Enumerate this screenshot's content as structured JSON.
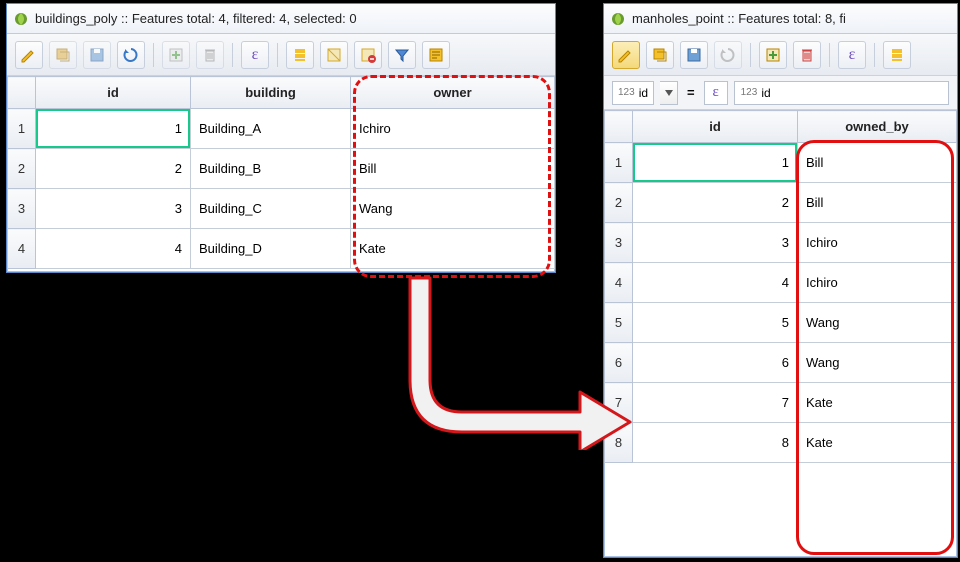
{
  "left": {
    "title": "buildings_poly :: Features total: 4, filtered: 4, selected: 0",
    "columns": [
      "id",
      "building",
      "owner"
    ],
    "rows": [
      {
        "n": "1",
        "id": "1",
        "building": "Building_A",
        "owner": "Ichiro"
      },
      {
        "n": "2",
        "id": "2",
        "building": "Building_B",
        "owner": "Bill"
      },
      {
        "n": "3",
        "id": "3",
        "building": "Building_C",
        "owner": "Wang"
      },
      {
        "n": "4",
        "id": "4",
        "building": "Building_D",
        "owner": "Kate"
      }
    ]
  },
  "right": {
    "title": "manholes_point :: Features total: 8, fi",
    "expr_field": "id",
    "expr_target": "id",
    "columns": [
      "id",
      "owned_by"
    ],
    "rows": [
      {
        "n": "1",
        "id": "1",
        "owned_by": "Bill"
      },
      {
        "n": "2",
        "id": "2",
        "owned_by": "Bill"
      },
      {
        "n": "3",
        "id": "3",
        "owned_by": "Ichiro"
      },
      {
        "n": "4",
        "id": "4",
        "owned_by": "Ichiro"
      },
      {
        "n": "5",
        "id": "5",
        "owned_by": "Wang"
      },
      {
        "n": "6",
        "id": "6",
        "owned_by": "Wang"
      },
      {
        "n": "7",
        "id": "7",
        "owned_by": "Kate"
      },
      {
        "n": "8",
        "id": "8",
        "owned_by": "Kate"
      }
    ]
  },
  "icons": {
    "pencil": "pencil-icon",
    "edit": "edit-icon",
    "save": "save-icon",
    "refresh": "refresh-icon",
    "newfield": "newfield-icon",
    "delete": "delete-icon",
    "epsilon": "epsilon-icon",
    "selectall": "selectall-icon",
    "invert": "invert-icon",
    "deselect": "deselect-icon",
    "filter": "filter-icon",
    "form": "form-icon"
  }
}
